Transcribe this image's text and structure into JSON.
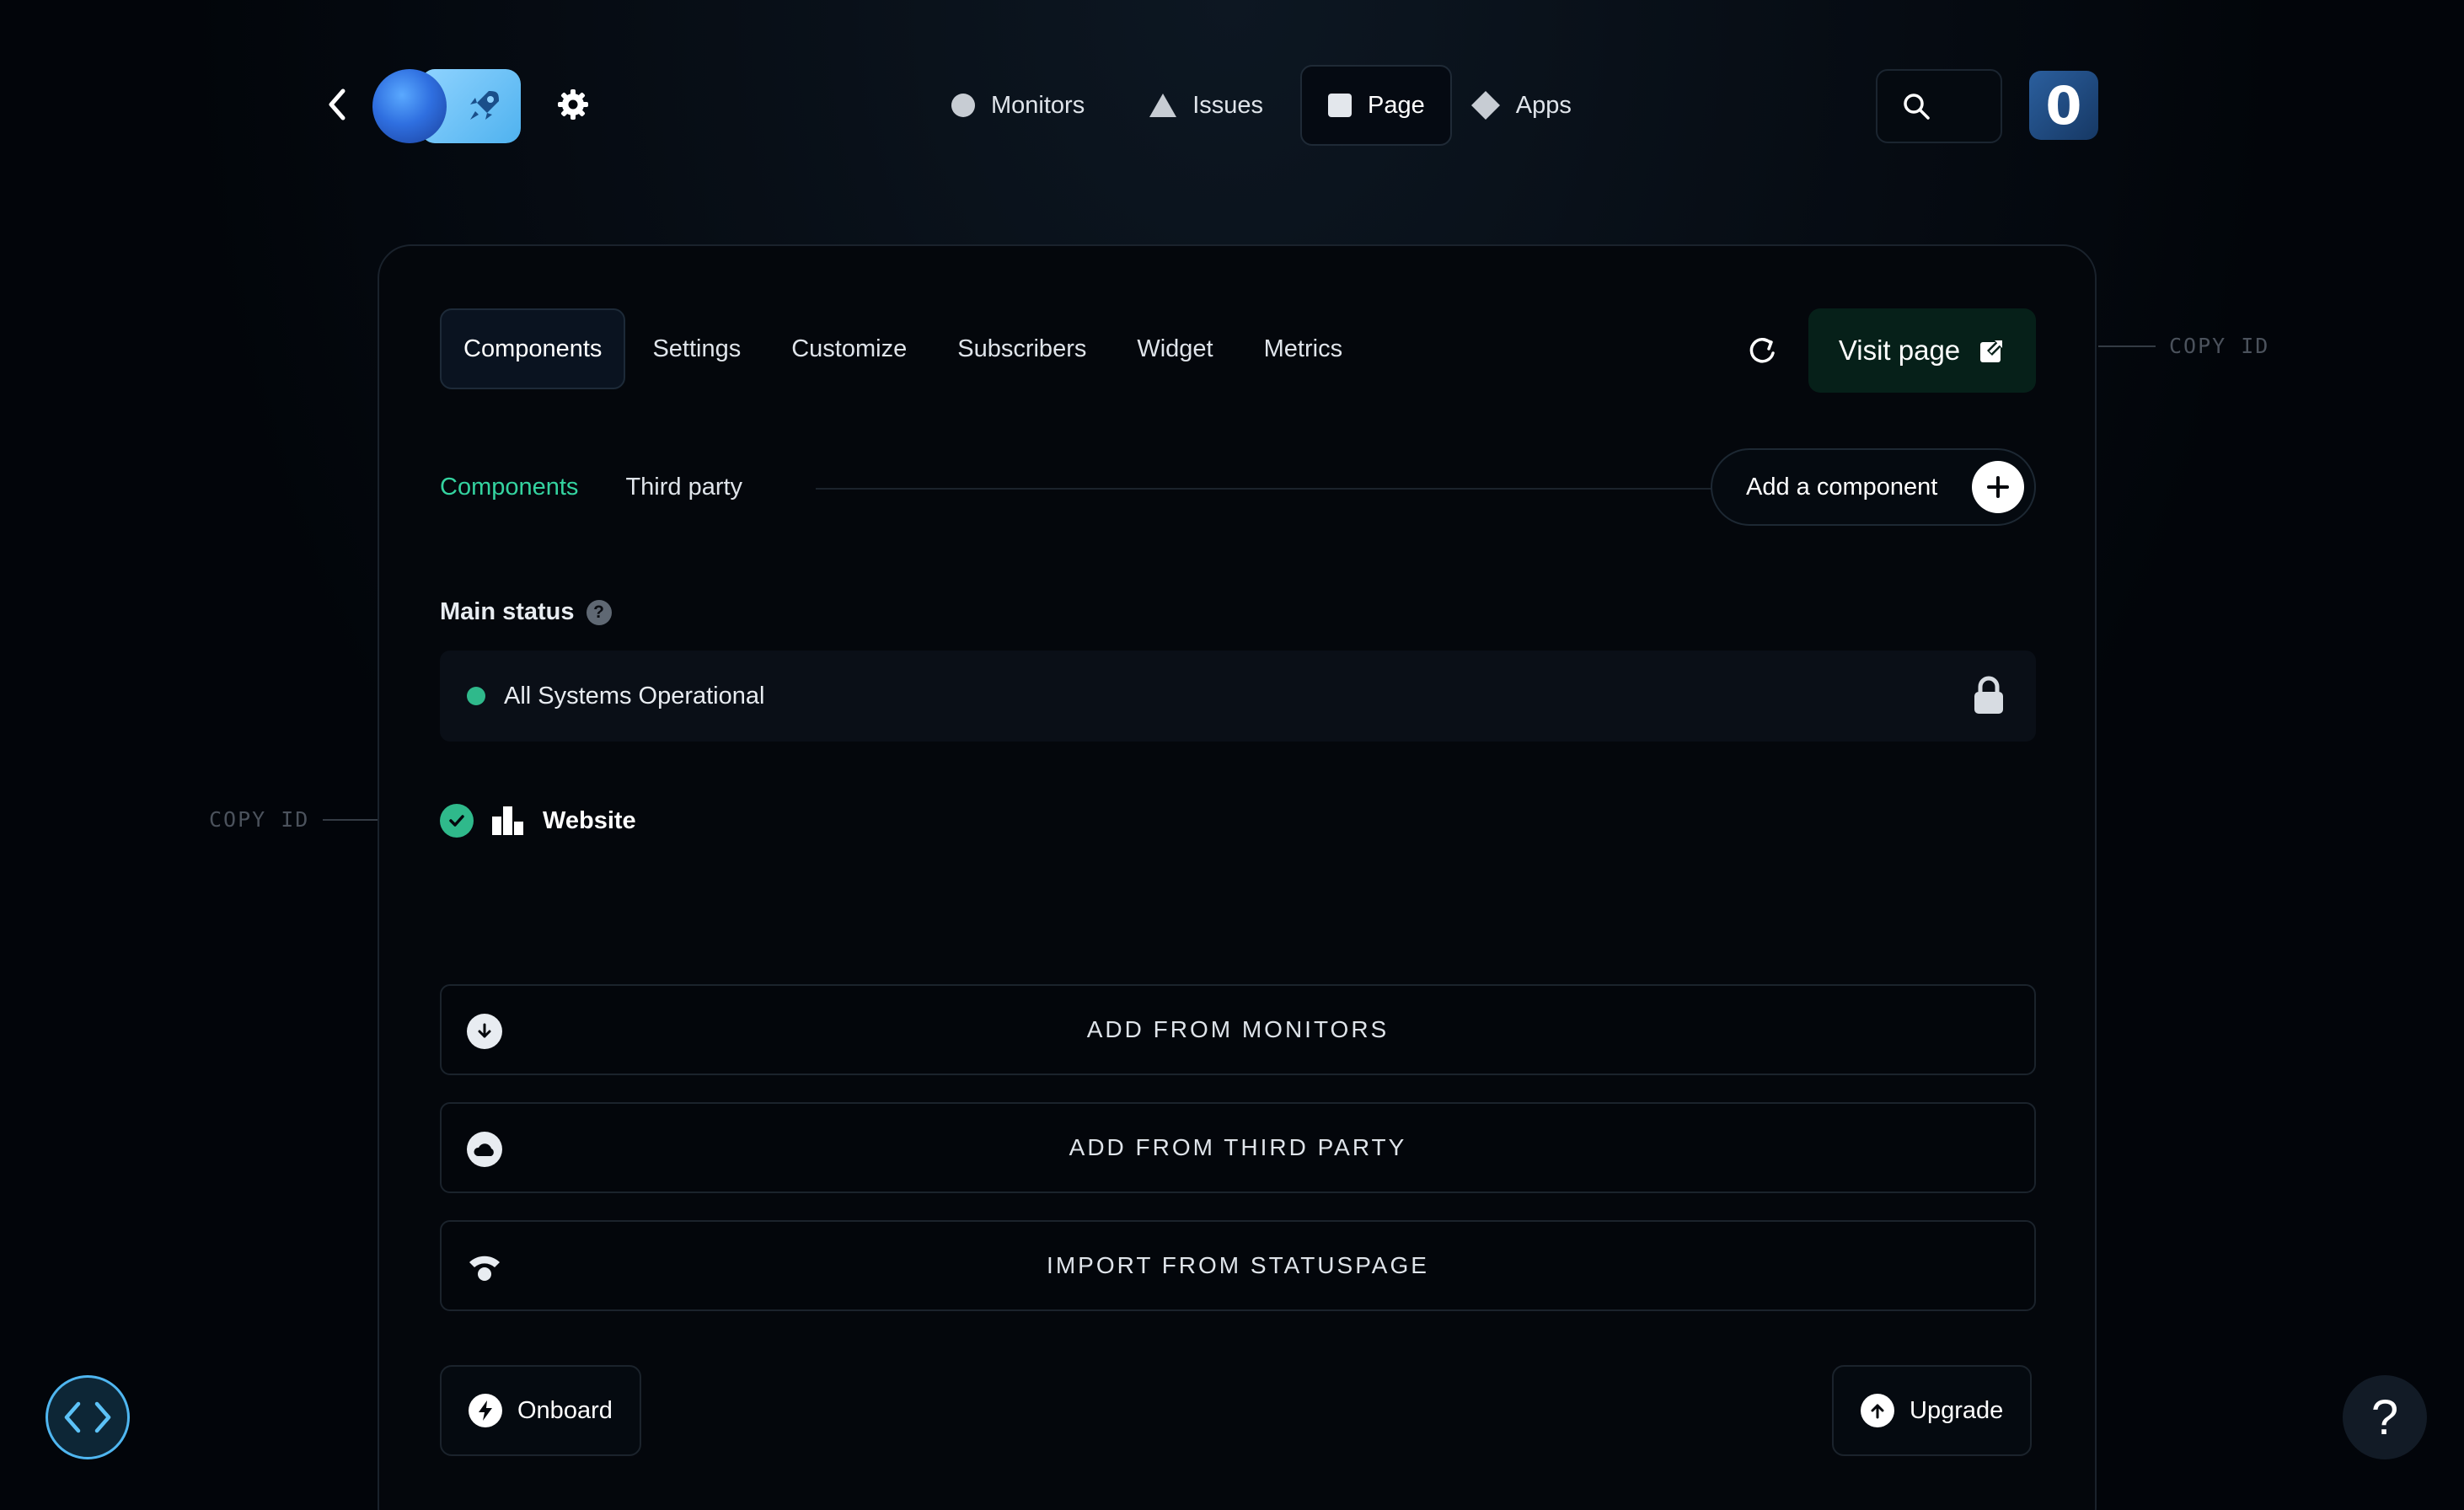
{
  "nav": {
    "items": [
      {
        "label": "Monitors",
        "icon": "circle-icon",
        "active": false
      },
      {
        "label": "Issues",
        "icon": "triangle-icon",
        "active": false
      },
      {
        "label": "Page",
        "icon": "square-icon",
        "active": true
      },
      {
        "label": "Apps",
        "icon": "diamond-icon",
        "active": false
      }
    ],
    "avatar_initial": "0"
  },
  "side": {
    "copy_id_right": "COPY ID",
    "copy_id_left": "COPY ID"
  },
  "card": {
    "tabs": [
      "Components",
      "Settings",
      "Customize",
      "Subscribers",
      "Widget",
      "Metrics"
    ],
    "visit_label": "Visit page",
    "subtabs": [
      "Components",
      "Third party"
    ],
    "add_component_label": "Add a component",
    "main_status_label": "Main status",
    "help_glyph": "?",
    "main_status_value": "All Systems Operational",
    "component_name": "Website",
    "actions": [
      "ADD FROM MONITORS",
      "ADD FROM THIRD PARTY",
      "IMPORT FROM STATUSPAGE"
    ],
    "onboard_label": "Onboard",
    "upgrade_label": "Upgrade"
  },
  "floating": {
    "help_glyph": "?"
  },
  "colors": {
    "accent_green": "#34d3a0",
    "status_green": "#2fb98b",
    "dev_button_blue": "#4fb6f0",
    "background": "#02050a"
  }
}
